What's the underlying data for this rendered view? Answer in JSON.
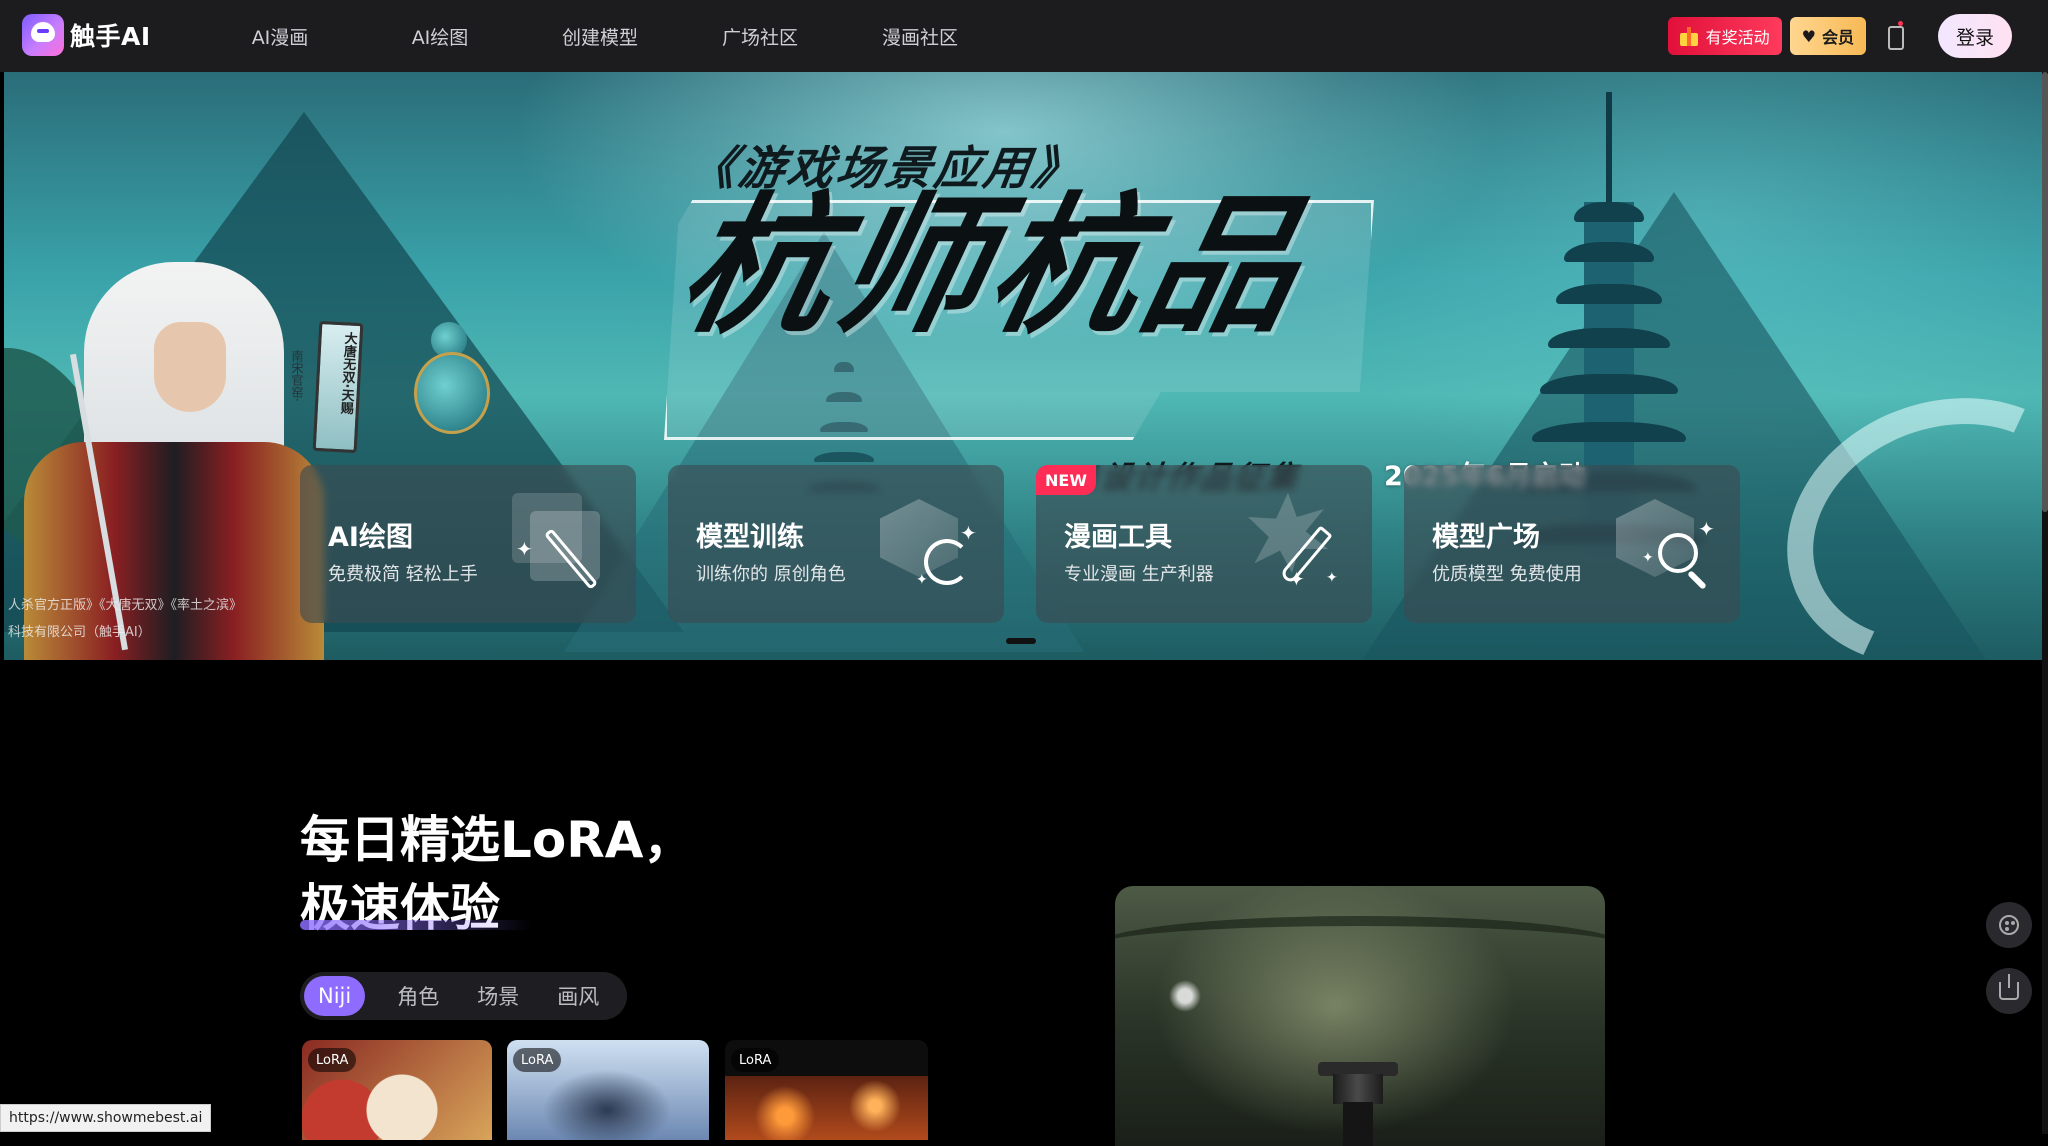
{
  "brand": {
    "name": "触手AI",
    "logo_icon": "chushou-logo-icon"
  },
  "nav": {
    "links": [
      "AI漫画",
      "AI绘图",
      "创建模型",
      "广场社区",
      "漫画社区"
    ],
    "promo_label": "有奖活动",
    "vip_label": "会员",
    "login_label": "登录",
    "icons": {
      "promo": "gift-icon",
      "vip": "diamond-icon",
      "mobile": "phone-icon"
    }
  },
  "banner": {
    "subtitle": "《游戏场景应用》",
    "title": "杭师杭品",
    "tagline": "AI设计作品征集",
    "date": "2025年6月启动",
    "tablet_text": "大唐无双·天赐",
    "vertical_text": "南宋官窑·",
    "credit_lines": [
      "人杀官方正版》《大唐无双》《率土之滨》",
      "科技有限公司（触手AI）"
    ]
  },
  "features": [
    {
      "title": "AI绘图",
      "desc": "免费极简 轻松上手",
      "icon": "magic-wand-icon"
    },
    {
      "title": "模型训练",
      "desc": "训练你的 原创角色",
      "icon": "cube-train-icon"
    },
    {
      "title": "漫画工具",
      "desc": "专业漫画 生产利器",
      "icon": "pen-tool-icon",
      "badge": "NEW"
    },
    {
      "title": "模型广场",
      "desc": "优质模型 免费使用",
      "icon": "model-search-icon"
    }
  ],
  "section": {
    "title_line1": "每日精选LoRA，",
    "title_line2": "极速体验",
    "tabs": [
      "Niji",
      "角色",
      "场景",
      "画风"
    ],
    "active_tab": "Niji",
    "card_badge": "LoRA"
  },
  "floating": {
    "icons": [
      "palette-icon",
      "share-icon"
    ]
  },
  "status_bar": {
    "url": "https://www.showmebest.ai"
  },
  "colors": {
    "accent": "#8d6cff",
    "promo": "#e0103a",
    "vip": "#f7b955",
    "new_badge": "#ff2d55",
    "nav_bg": "#1c1c1e"
  }
}
